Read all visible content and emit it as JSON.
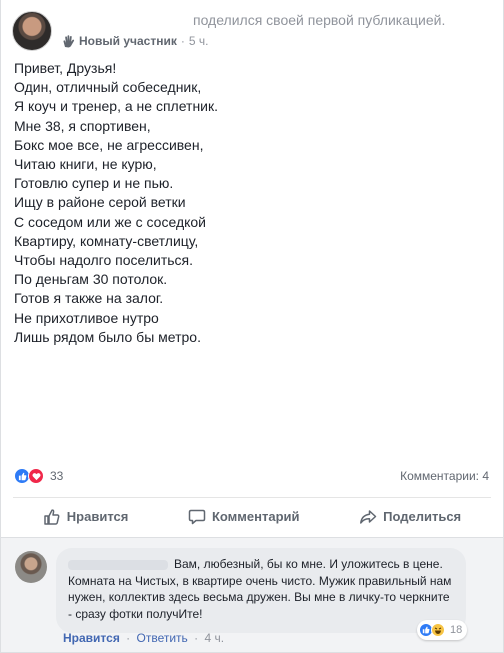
{
  "post": {
    "shared_text": "поделился своей первой публикацией.",
    "badge_icon": "wave-hand-icon",
    "badge_label": "Новый участник",
    "separator": "·",
    "time": "5 ч.",
    "lines": [
      "Привет, Друзья!",
      "Один, отличный собеседник,",
      "Я коуч и тренер, а не сплетник.",
      "Мне 38, я спортивен,",
      "Бокс мое все, не агрессивен,",
      "Читаю книги, не курю,",
      "Готовлю супер и не пью.",
      "Ищу в районе серой ветки",
      "С соседом или же с соседкой",
      "Квартиру, комнату-светлицу,",
      "Чтобы надолго поселиться.",
      "По деньгам 30 потолок.",
      "Готов я также на залог.",
      "Не прихотливое нутро",
      "Лишь рядом было бы метро."
    ]
  },
  "stats": {
    "reactions_count": "33",
    "comments_count": "Комментарии: 4"
  },
  "actions": {
    "like": "Нравится",
    "comment": "Комментарий",
    "share": "Поделиться"
  },
  "comment": {
    "text": "Вам, любезный, бы ко мне. И уложитесь в цене. Комната на Чистых, в квартире очень чисто. Мужик правильный нам нужен, коллектив здесь весьма дружен. Вы мне в личку-то черкните - сразу фотки получИте!",
    "reactions_count": "18",
    "like": "Нравится",
    "reply": "Ответить",
    "separator": "·",
    "time": "4 ч."
  },
  "colors": {
    "link_blue": "#4267b2",
    "like_blue": "#2e7bf6",
    "love_red": "#f0284a",
    "haha_yellow": "#f7c444",
    "muted_gray": "#90949c"
  }
}
